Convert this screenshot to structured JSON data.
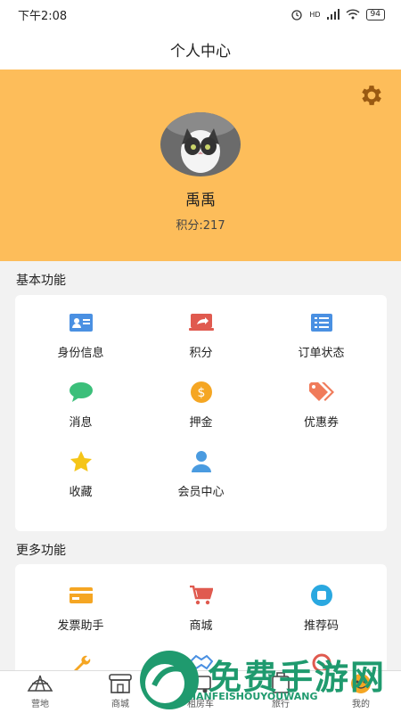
{
  "status_bar": {
    "time": "下午2:08",
    "network": "HD",
    "battery": "94"
  },
  "header": {
    "title": "个人中心"
  },
  "profile": {
    "username": "禹禹",
    "points_label": "积分:217"
  },
  "basic": {
    "title": "基本功能",
    "items": [
      {
        "label": "身份信息",
        "icon": "id-card-icon",
        "color": "#4a90e2"
      },
      {
        "label": "积分",
        "icon": "share-screen-icon",
        "color": "#e05a4f"
      },
      {
        "label": "订单状态",
        "icon": "list-icon",
        "color": "#4a90e2"
      },
      {
        "label": "消息",
        "icon": "chat-bubble-icon",
        "color": "#3bbf7a"
      },
      {
        "label": "押金",
        "icon": "dollar-coin-icon",
        "color": "#f5a623"
      },
      {
        "label": "优惠券",
        "icon": "tag-icon",
        "color": "#f07b5a"
      },
      {
        "label": "收藏",
        "icon": "star-icon",
        "color": "#f5c518"
      },
      {
        "label": "会员中心",
        "icon": "user-icon",
        "color": "#4a9be0"
      }
    ]
  },
  "more": {
    "title": "更多功能",
    "items": [
      {
        "label": "发票助手",
        "icon": "credit-card-icon",
        "color": "#f5a623"
      },
      {
        "label": "商城",
        "icon": "shopping-cart-icon",
        "color": "#e05a4f"
      },
      {
        "label": "推荐码",
        "icon": "qr-bubble-icon",
        "color": "#2aa8e0"
      },
      {
        "label": "",
        "icon": "wrench-icon",
        "color": "#f5a623"
      },
      {
        "label": "",
        "icon": "handshake-icon",
        "color": "#4a90e2"
      },
      {
        "label": "",
        "icon": "tool-icon",
        "color": "#e05a4f"
      }
    ]
  },
  "tabbar": {
    "tabs": [
      {
        "label": "营地",
        "icon": "tent-icon"
      },
      {
        "label": "商城",
        "icon": "shop-icon"
      },
      {
        "label": "租房车",
        "icon": "rv-icon"
      },
      {
        "label": "旅行",
        "icon": "luggage-icon"
      },
      {
        "label": "我的",
        "icon": "profile-icon"
      }
    ]
  },
  "watermark": {
    "text": "免费手游网",
    "subtext": "MIANFEISHOUYOUWANG"
  }
}
